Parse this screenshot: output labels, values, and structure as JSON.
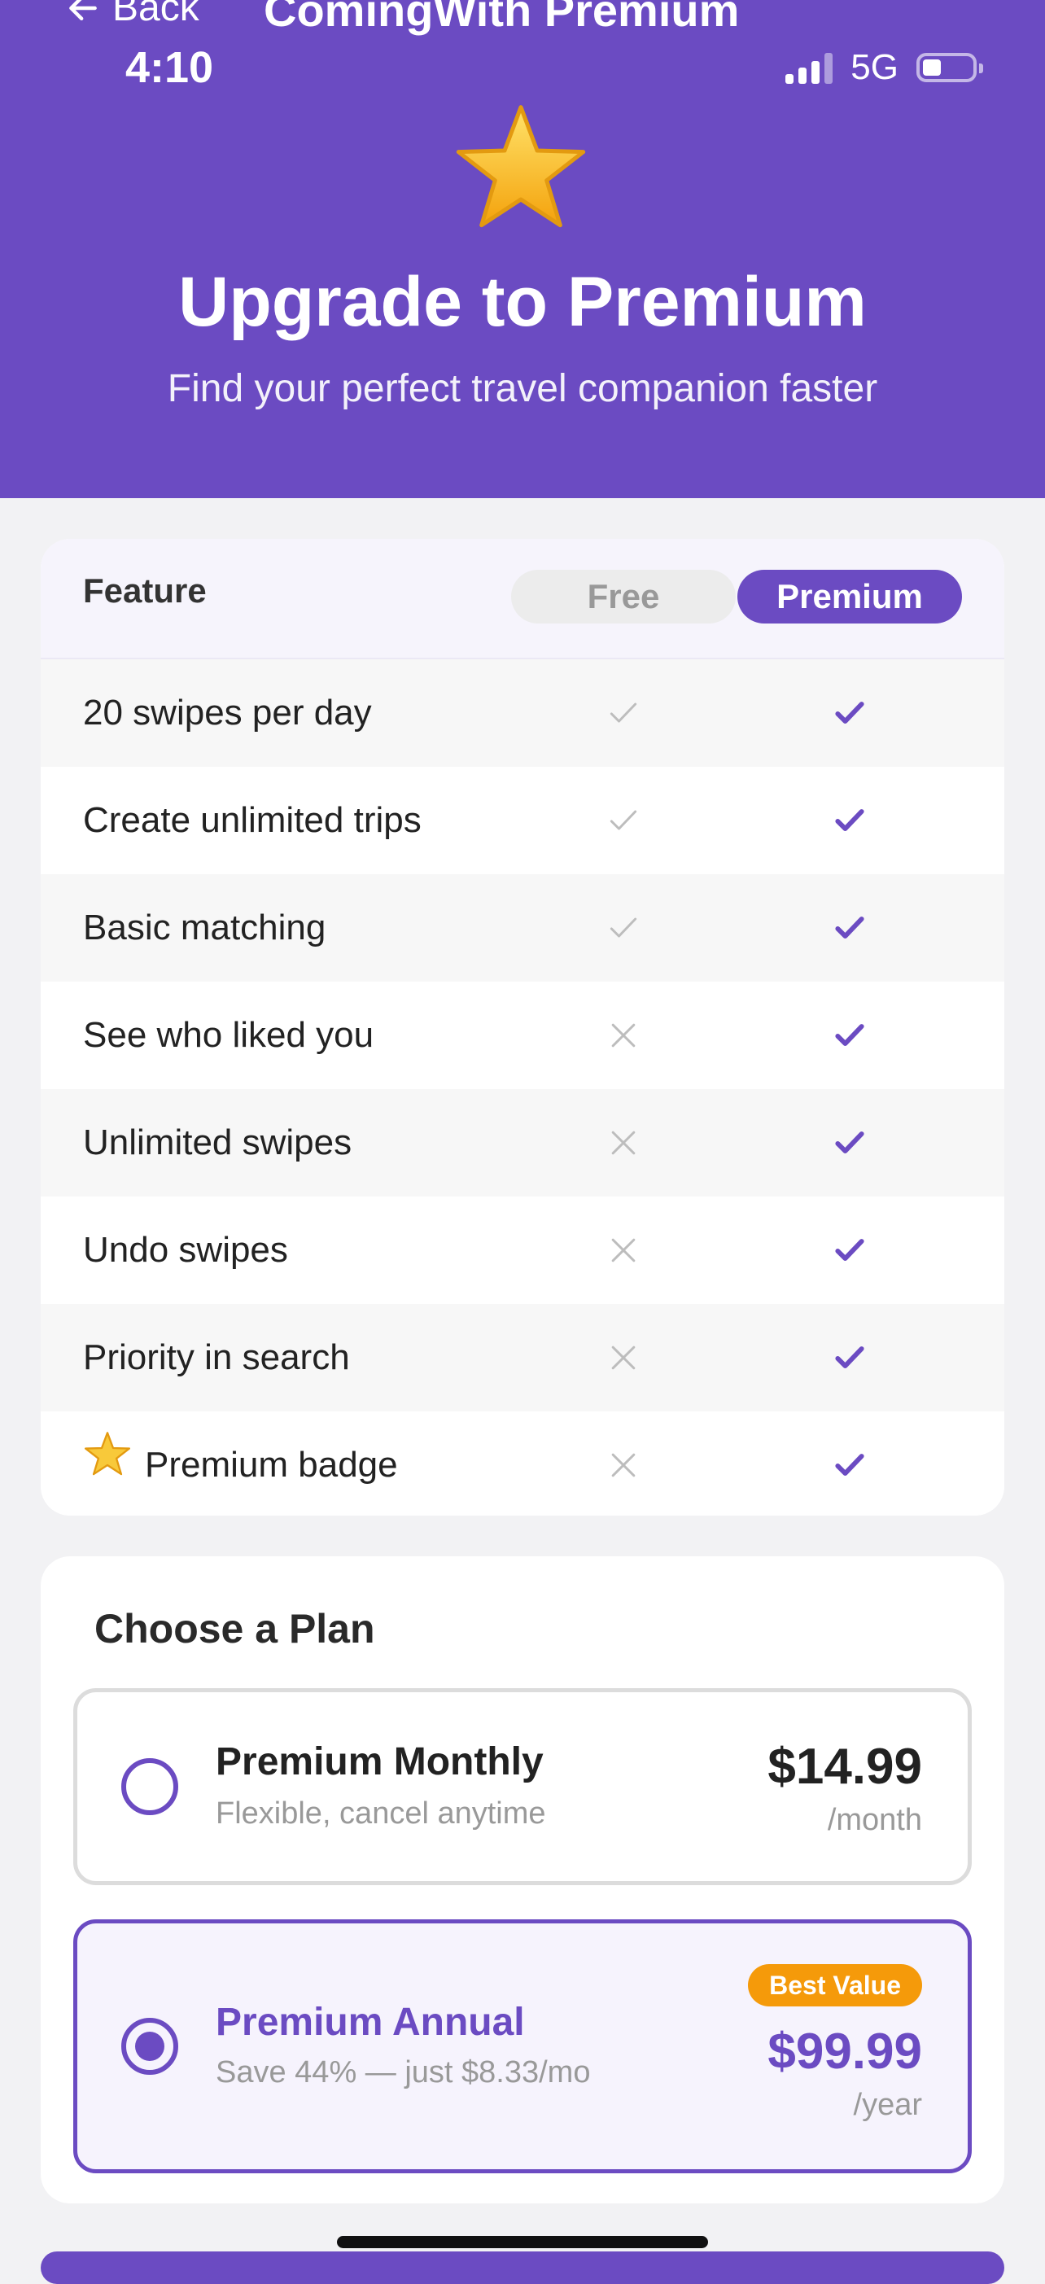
{
  "nav": {
    "back_label": "Back",
    "title": "ComingWith Premium"
  },
  "status_bar": {
    "time": "4:10",
    "network": "5G"
  },
  "hero": {
    "title": "Upgrade to Premium",
    "subtitle": "Find your perfect travel companion faster"
  },
  "features": {
    "header": {
      "feature": "Feature",
      "free": "Free",
      "premium": "Premium"
    },
    "rows": [
      {
        "name": "20 swipes per day",
        "free": "check",
        "premium": "check"
      },
      {
        "name": "Create unlimited trips",
        "free": "check",
        "premium": "check"
      },
      {
        "name": "Basic matching",
        "free": "check",
        "premium": "check"
      },
      {
        "name": "See who liked you",
        "free": "cross",
        "premium": "check"
      },
      {
        "name": "Unlimited swipes",
        "free": "cross",
        "premium": "check"
      },
      {
        "name": "Undo swipes",
        "free": "cross",
        "premium": "check"
      },
      {
        "name": "Priority in search",
        "free": "cross",
        "premium": "check"
      },
      {
        "name": "Premium badge",
        "free": "cross",
        "premium": "check",
        "icon": "star-icon"
      }
    ]
  },
  "plans": {
    "title": "Choose a Plan",
    "monthly": {
      "name": "Premium Monthly",
      "description": "Flexible, cancel anytime",
      "price": "$14.99",
      "period": "/month",
      "selected": false
    },
    "annual": {
      "name": "Premium Annual",
      "description": "Save 44% — just $8.33/mo",
      "price": "$99.99",
      "period": "/year",
      "badge": "Best Value",
      "selected": true
    }
  },
  "colors": {
    "brand": "#6b4bc2",
    "badge": "#f59a0a"
  }
}
